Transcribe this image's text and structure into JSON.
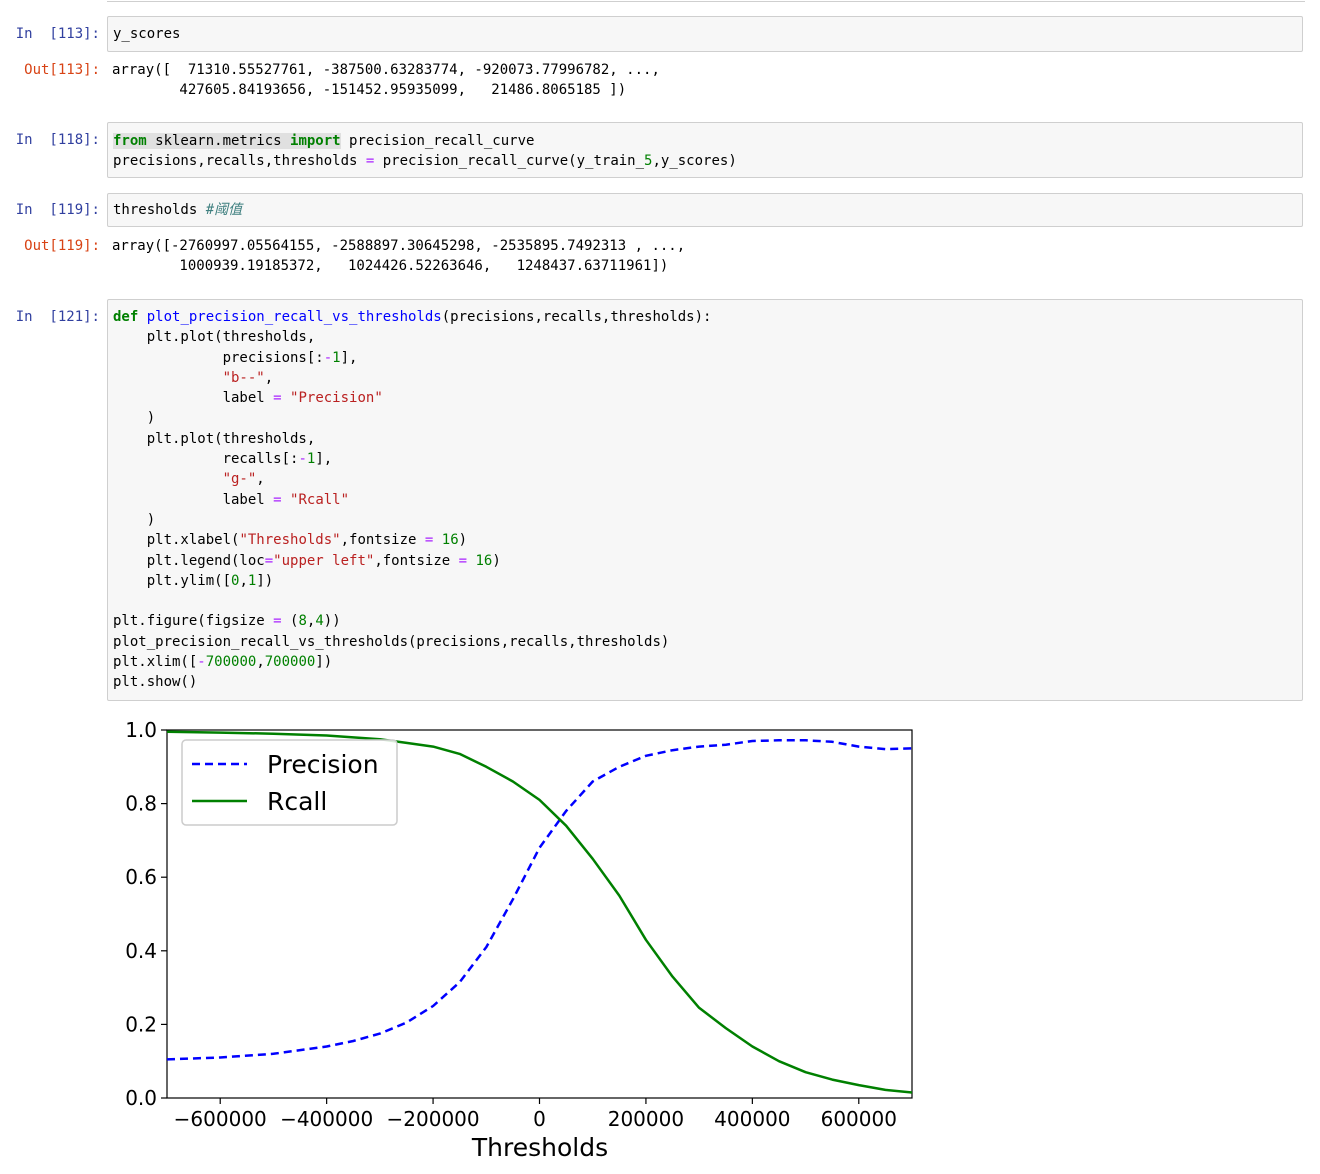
{
  "cells": [
    {
      "in_prompt": "In  [113]:",
      "code": "y_scores",
      "out_prompt": "Out[113]:",
      "output": "array([  71310.55527761, -387500.63283774, -920073.77996782, ...,\n        427605.84193656, -151452.95935099,   21486.8065185 ])"
    },
    {
      "in_prompt": "In  [118]:",
      "code": "from sklearn.metrics import precision_recall_curve\nprecisions,recalls,thresholds = precision_recall_curve(y_train_5,y_scores)"
    },
    {
      "in_prompt": "In  [119]:",
      "code": "thresholds #阈值",
      "out_prompt": "Out[119]:",
      "output": "array([-2760997.05564155, -2588897.30645298, -2535895.7492313 , ...,\n        1000939.19185372,   1024426.52263646,   1248437.63711961])"
    },
    {
      "in_prompt": "In  [121]:",
      "code": "def plot_precision_recall_vs_thresholds(precisions,recalls,thresholds):\n    plt.plot(thresholds,\n             precisions[:-1],\n             \"b--\",\n             label = \"Precision\"\n    )\n    plt.plot(thresholds,\n             recalls[:-1],\n             \"g-\",\n             label = \"Rcall\"\n    )\n    plt.xlabel(\"Thresholds\",fontsize = 16)\n    plt.legend(loc=\"upper left\",fontsize = 16)\n    plt.ylim([0,1])\n\nplt.figure(figsize = (8,4))\nplot_precision_recall_vs_thresholds(precisions,recalls,thresholds)\nplt.xlim([-700000,700000])\nplt.show()"
    }
  ],
  "colors": {
    "in_prompt": "#303f9f",
    "out_prompt": "#d84315",
    "precision": "#0000ff",
    "recall": "#008000"
  },
  "chart_data": {
    "type": "line",
    "title": "",
    "xlabel": "Thresholds",
    "ylabel": "",
    "xlim": [
      -700000,
      700000
    ],
    "ylim": [
      0,
      1
    ],
    "xticks": [
      -600000,
      -400000,
      -200000,
      0,
      200000,
      400000,
      600000
    ],
    "xtick_labels": [
      "−600000",
      "−400000",
      "−200000",
      "0",
      "200000",
      "400000",
      "600000"
    ],
    "yticks": [
      0.0,
      0.2,
      0.4,
      0.6,
      0.8,
      1.0
    ],
    "ytick_labels": [
      "0.0",
      "0.2",
      "0.4",
      "0.6",
      "0.8",
      "1.0"
    ],
    "legend_position": "upper left",
    "grid": false,
    "x": [
      -700000,
      -600000,
      -500000,
      -400000,
      -350000,
      -300000,
      -250000,
      -200000,
      -150000,
      -100000,
      -50000,
      0,
      50000,
      100000,
      150000,
      200000,
      250000,
      300000,
      350000,
      400000,
      450000,
      500000,
      550000,
      600000,
      650000,
      700000
    ],
    "series": [
      {
        "name": "Precision",
        "style": "b--",
        "color": "#0000ff",
        "values": [
          0.105,
          0.11,
          0.12,
          0.14,
          0.155,
          0.175,
          0.205,
          0.25,
          0.315,
          0.41,
          0.54,
          0.68,
          0.78,
          0.86,
          0.9,
          0.93,
          0.945,
          0.955,
          0.96,
          0.97,
          0.972,
          0.972,
          0.968,
          0.955,
          0.948,
          0.95
        ]
      },
      {
        "name": "Rcall",
        "style": "g-",
        "color": "#008000",
        "values": [
          0.995,
          0.993,
          0.99,
          0.985,
          0.98,
          0.975,
          0.965,
          0.955,
          0.935,
          0.9,
          0.86,
          0.81,
          0.74,
          0.65,
          0.55,
          0.43,
          0.33,
          0.245,
          0.19,
          0.14,
          0.1,
          0.07,
          0.05,
          0.035,
          0.022,
          0.015
        ]
      }
    ]
  }
}
